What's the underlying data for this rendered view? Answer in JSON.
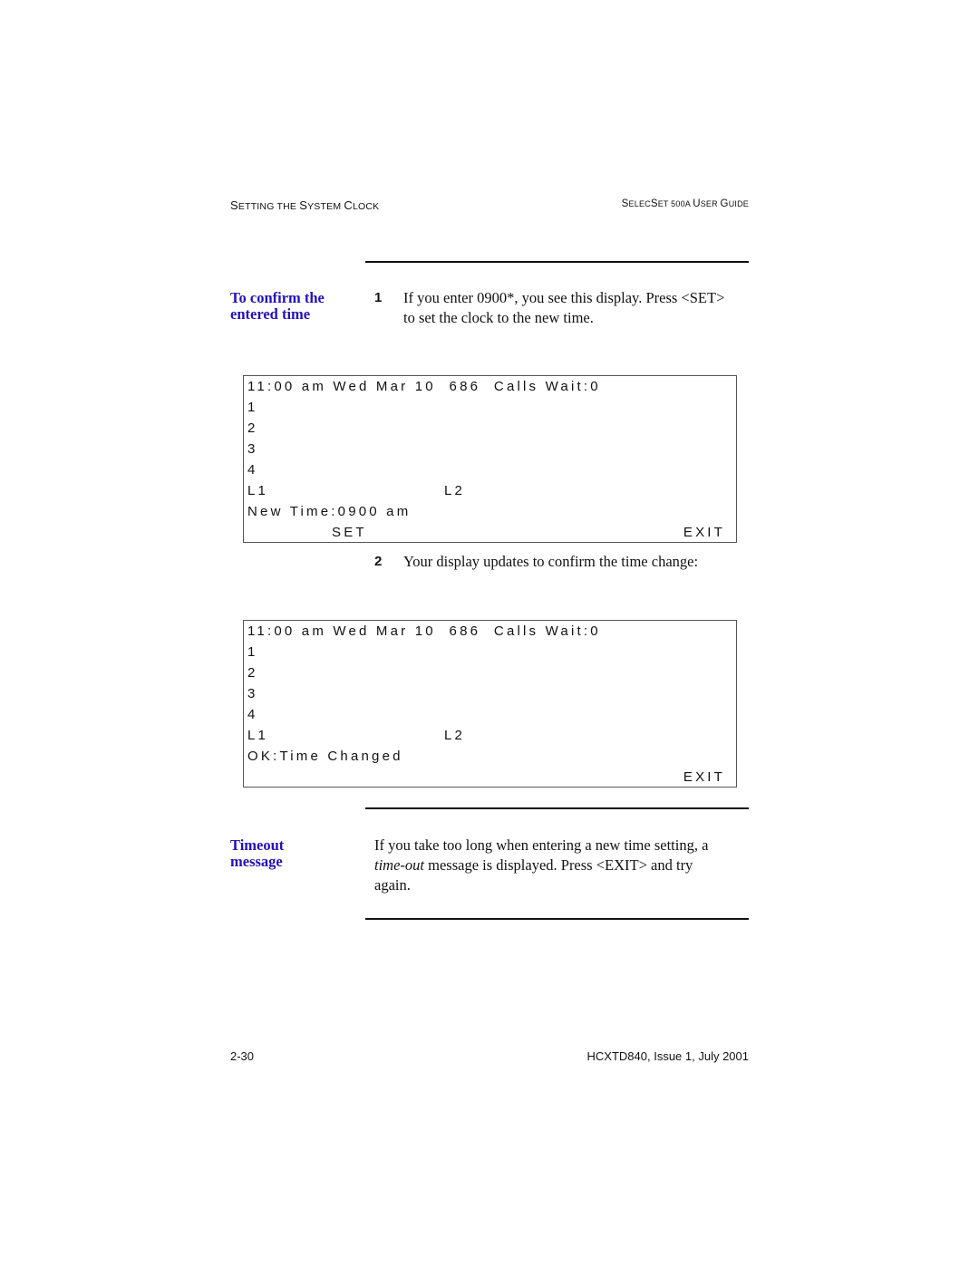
{
  "header": {
    "left": [
      "S",
      "ETTING THE ",
      "S",
      "YSTEM ",
      "C",
      "LOCK"
    ],
    "right": [
      "S",
      "ELEC",
      "S",
      "ET 500A ",
      "U",
      "SER ",
      "G",
      "UIDE"
    ]
  },
  "section1": {
    "side_heading_line1": "To confirm the",
    "side_heading_line2": "entered time",
    "step1_num": "1",
    "step1_line1": "If you enter 0900*, you see this display. Press <SET>",
    "step1_line2": "to set the clock to the new time.",
    "display1": {
      "status_line": "11:00 am Wed Mar 10  686  Calls Wait:0",
      "lines": [
        "1",
        "2",
        "3",
        "4"
      ],
      "l1": "L1",
      "l2": "L2",
      "prompt": "New Time:0900 am",
      "softkey_left": "SET",
      "softkey_right": "EXIT"
    },
    "step2_num": "2",
    "step2_text": "Your display updates to confirm the time change:",
    "display2": {
      "status_line": "11:00 am Wed Mar 10  686  Calls Wait:0",
      "lines": [
        "1",
        "2",
        "3",
        "4"
      ],
      "l1": "L1",
      "l2": "L2",
      "prompt": "OK:Time Changed",
      "softkey_right": "EXIT"
    }
  },
  "section2": {
    "side_heading_line1": "Timeout",
    "side_heading_line2": "message",
    "para_line1": "If you take too long when entering a new time setting, a",
    "para_line2_em": "time-out",
    "para_line2_rest": " message is displayed. Press <EXIT> and try",
    "para_line3": "again."
  },
  "footer": {
    "page_number": "2-30",
    "doc_id": "HCXTD840, Issue 1, July 2001"
  }
}
